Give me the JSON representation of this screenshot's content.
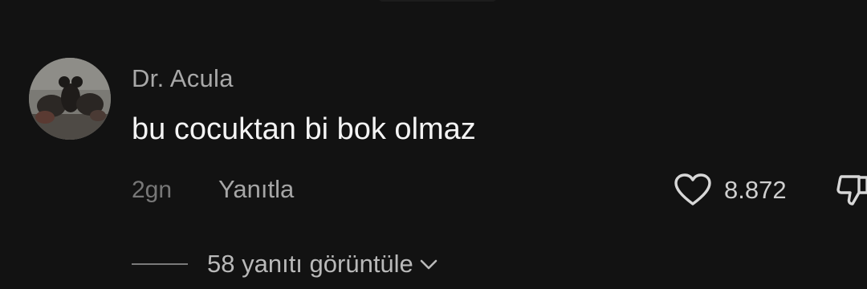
{
  "comment": {
    "username": "Dr. Acula",
    "text": "bu cocuktan bi bok olmaz",
    "timestamp": "2gn",
    "reply_label": "Yanıtla",
    "like_count": "8.872",
    "view_replies_label": "58 yanıtı görüntüle"
  },
  "icons": {
    "like": "heart-icon",
    "dislike": "thumbs-down-icon",
    "expand": "chevron-down-icon"
  },
  "colors": {
    "background": "#121212",
    "username": "#a8a8a8",
    "text": "#f4f4f4",
    "secondary": "#777777"
  }
}
